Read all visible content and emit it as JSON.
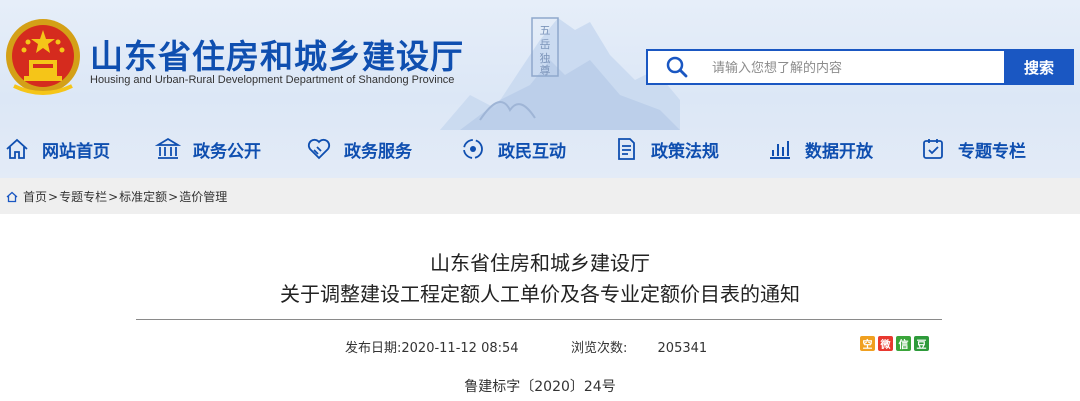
{
  "header": {
    "title": "山东省住房和城乡建设厅",
    "subtitle": "Housing and Urban-Rural Development Department of Shandong Province",
    "search": {
      "placeholder": "请输入您想了解的内容",
      "button": "搜索"
    }
  },
  "nav": [
    {
      "label": "网站首页",
      "icon": "home-icon"
    },
    {
      "label": "政务公开",
      "icon": "government-building-icon"
    },
    {
      "label": "政务服务",
      "icon": "handshake-icon"
    },
    {
      "label": "政民互动",
      "icon": "interaction-icon"
    },
    {
      "label": "政策法规",
      "icon": "policy-document-icon"
    },
    {
      "label": "数据开放",
      "icon": "bar-chart-icon"
    },
    {
      "label": "专题专栏",
      "icon": "special-column-icon"
    }
  ],
  "breadcrumb": [
    "首页",
    "专题专栏",
    "标准定额",
    "造价管理"
  ],
  "breadcrumb_separator": ">",
  "article": {
    "title_line1": "山东省住房和城乡建设厅",
    "title_line2": "关于调整建设工程定额人工单价及各专业定额价目表的通知",
    "publish_label": "发布日期:",
    "publish_date": "2020-11-12 08:54",
    "views_label": "浏览次数:",
    "views": "205341",
    "doc_number": "鲁建标字〔2020〕24号"
  },
  "share": [
    {
      "label": "空",
      "color": "#f0a020",
      "icon": "qzone-share-icon"
    },
    {
      "label": "微",
      "color": "#e8382f",
      "icon": "weibo-share-icon"
    },
    {
      "label": "信",
      "color": "#3aa53a",
      "icon": "wechat-share-icon"
    },
    {
      "label": "豆",
      "color": "#2d9a3a",
      "icon": "douban-share-icon"
    }
  ],
  "colors": {
    "brand": "#0f4fb0",
    "search_button": "#1a57c2"
  }
}
